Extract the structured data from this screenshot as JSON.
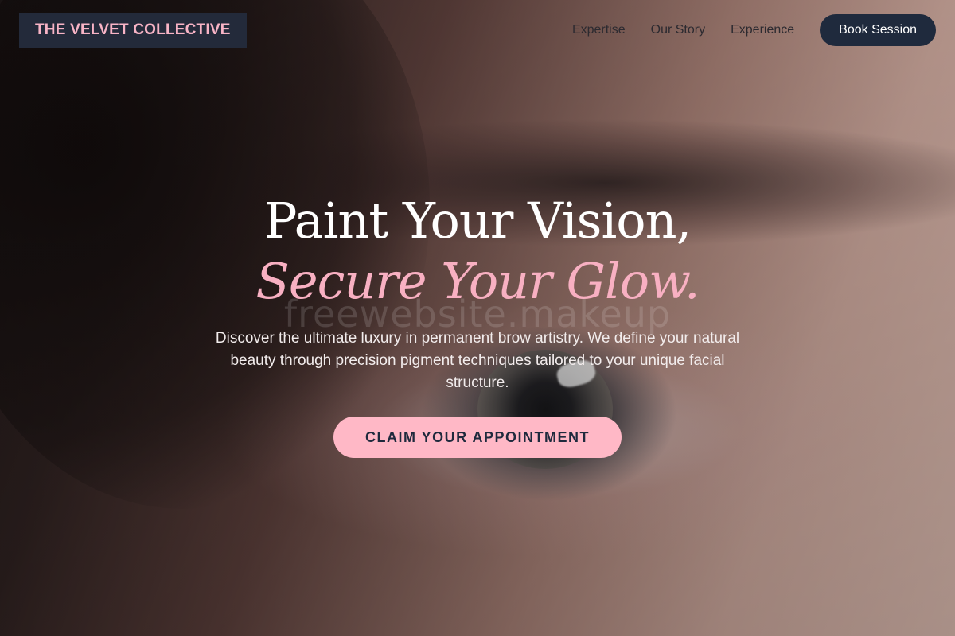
{
  "header": {
    "brand": "THE VELVET COLLECTIVE",
    "nav": [
      {
        "label": "Expertise"
      },
      {
        "label": "Our Story"
      },
      {
        "label": "Experience"
      }
    ],
    "book_label": "Book Session"
  },
  "hero": {
    "title_line1": "Paint Your Vision,",
    "title_line2": "Secure Your Glow.",
    "watermark": "freewebsite.makeup",
    "description": "Discover the ultimate luxury in permanent brow artistry. We define your natural beauty through precision pigment techniques tailored to your unique facial structure.",
    "cta_label": "CLAIM YOUR APPOINTMENT"
  },
  "colors": {
    "navy": "#1f2a3d",
    "pink": "#ffb8c6",
    "pink_text": "#f8b0c2"
  }
}
